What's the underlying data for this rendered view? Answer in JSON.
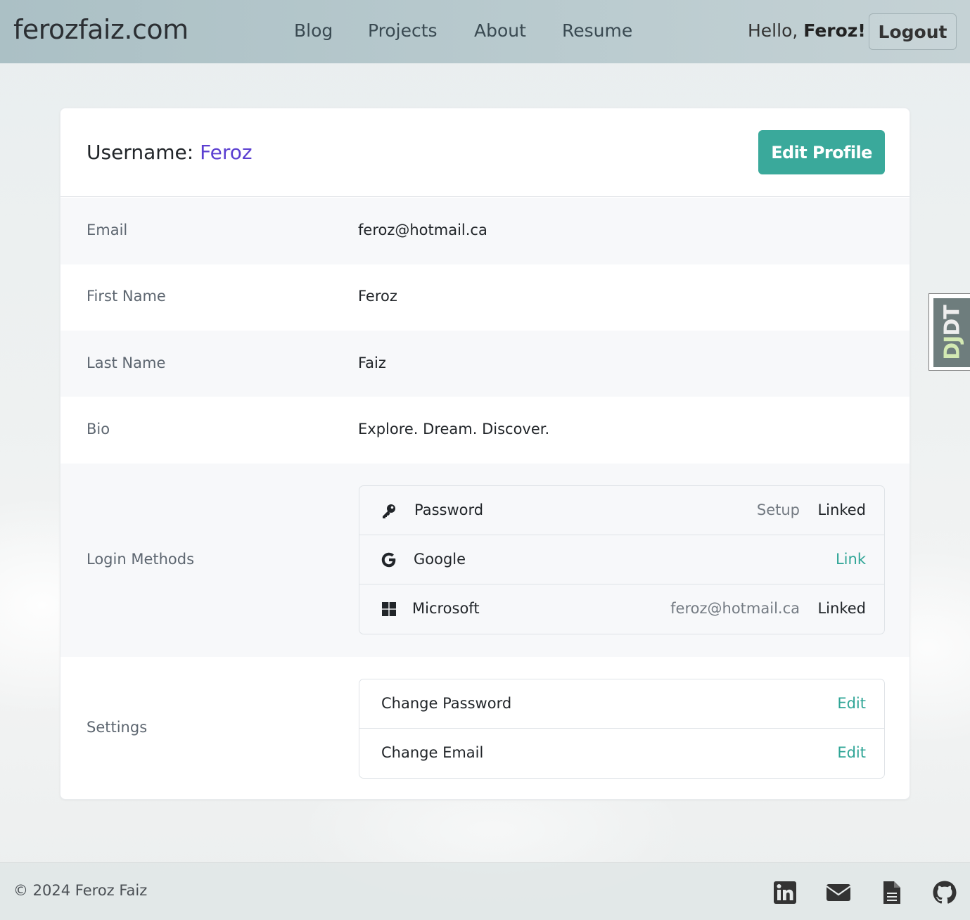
{
  "nav": {
    "brand": "ferozfaiz.com",
    "links": [
      "Blog",
      "Projects",
      "About",
      "Resume"
    ],
    "greeting_prefix": "Hello,",
    "greeting_name": "Feroz!",
    "logout_label": "Logout"
  },
  "profile": {
    "username_label": "Username:",
    "username_value": "Feroz",
    "edit_profile_label": "Edit Profile",
    "fields": [
      {
        "label": "Email",
        "value": "feroz@hotmail.ca"
      },
      {
        "label": "First Name",
        "value": "Feroz"
      },
      {
        "label": "Last Name",
        "value": "Faiz"
      },
      {
        "label": "Bio",
        "value": "Explore. Dream. Discover."
      }
    ],
    "login_methods_label": "Login Methods",
    "login_methods": [
      {
        "name": "Password",
        "icon": "key-icon",
        "detail": "Setup",
        "status": "Linked"
      },
      {
        "name": "Google",
        "icon": "google-icon",
        "detail": "",
        "status": "Link"
      },
      {
        "name": "Microsoft",
        "icon": "windows-icon",
        "detail": "feroz@hotmail.ca",
        "status": "Linked"
      }
    ],
    "settings_label": "Settings",
    "settings": [
      {
        "name": "Change Password",
        "action": "Edit"
      },
      {
        "name": "Change Email",
        "action": "Edit"
      }
    ]
  },
  "djdt": {
    "prefix": "DJ",
    "suffix": "DT"
  },
  "footer": {
    "copyright": "© 2024 Feroz Faiz",
    "icons": [
      "linkedin-icon",
      "envelope-icon",
      "document-icon",
      "github-icon"
    ]
  },
  "colors": {
    "accent_teal": "#3aa99b",
    "link_teal": "#2fa596",
    "username_purple": "#5b3fd1",
    "navbar_bg": "#b4c6ca"
  }
}
